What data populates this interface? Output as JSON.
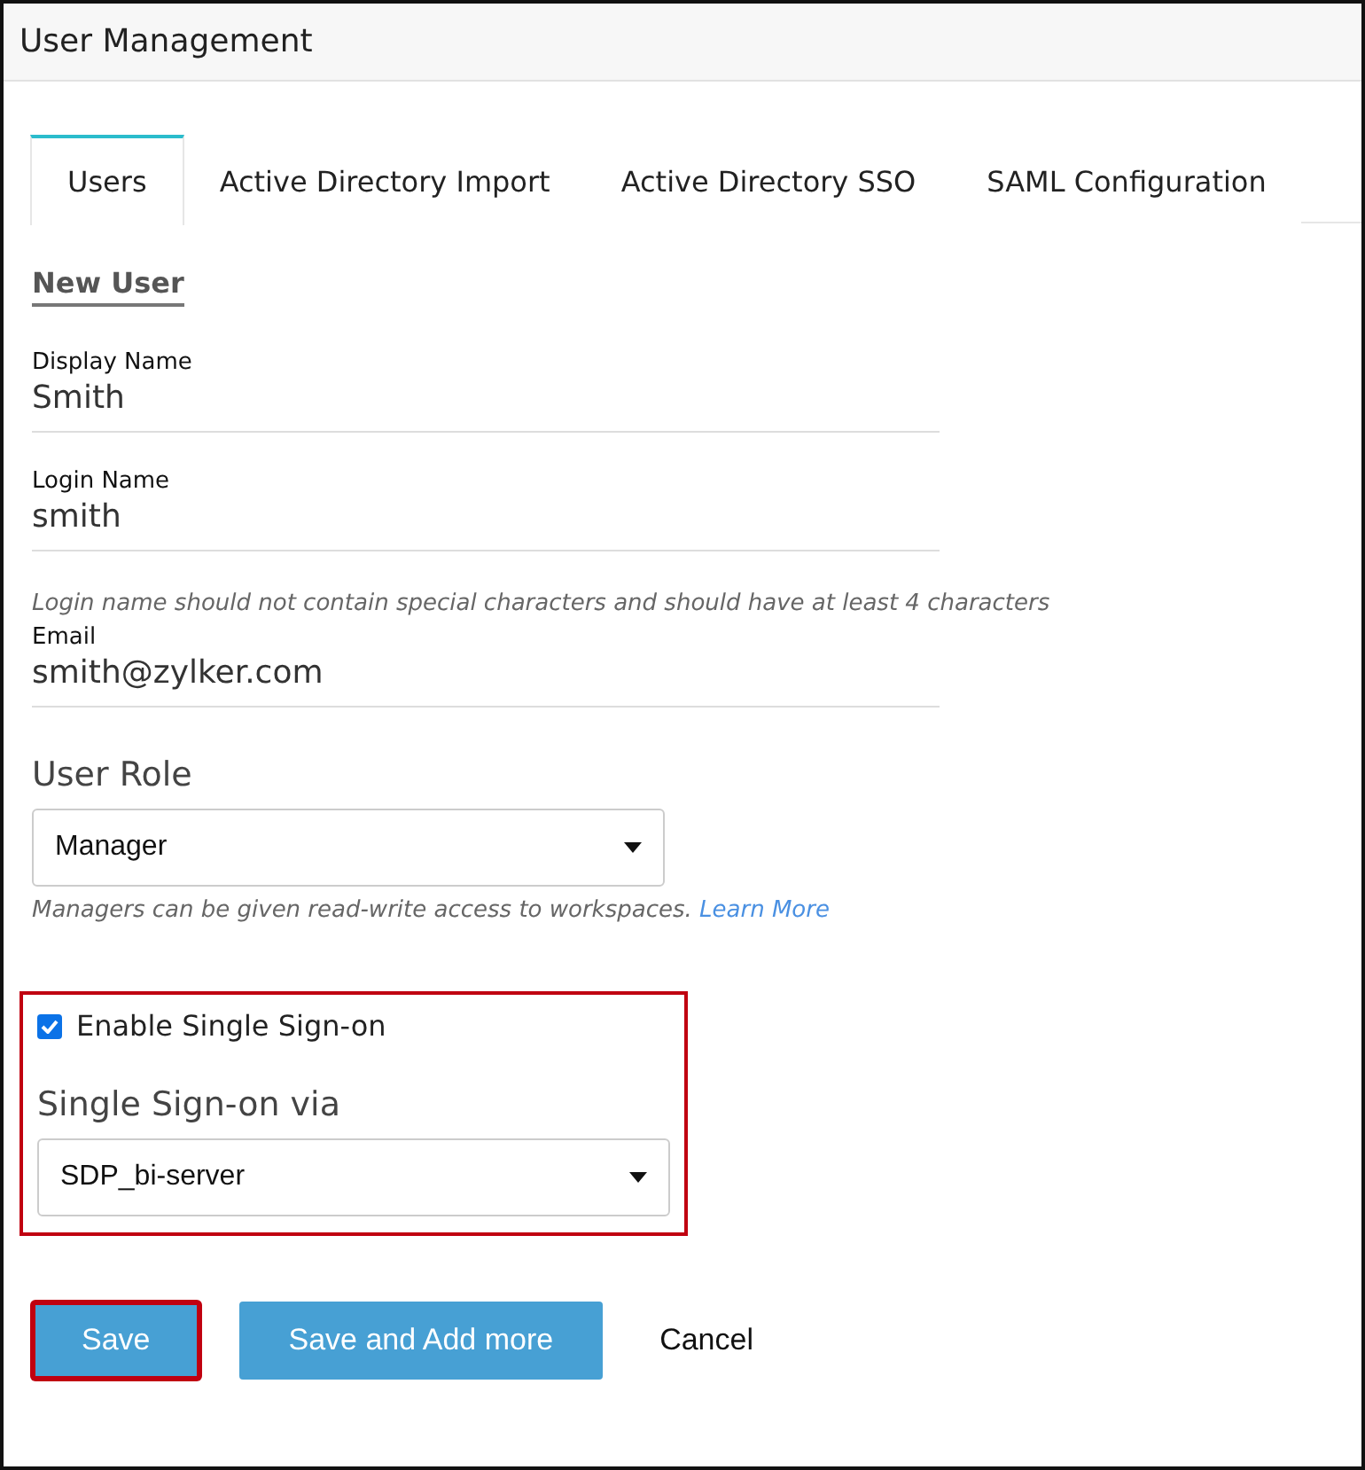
{
  "window": {
    "title": "User Management"
  },
  "tabs": [
    {
      "label": "Users",
      "selected": true
    },
    {
      "label": "Active Directory Import",
      "selected": false
    },
    {
      "label": "Active Directory SSO",
      "selected": false
    },
    {
      "label": "SAML Configuration",
      "selected": false
    }
  ],
  "section_title": "New User",
  "fields": [
    {
      "label": "Display Name",
      "value": "Smith"
    },
    {
      "label": "Login Name",
      "value": "smith",
      "hint": "Login name should not contain special characters and should have at least 4 characters"
    },
    {
      "label": "Email",
      "value": "smith@zylker.com"
    }
  ],
  "user_role": {
    "label": "User Role",
    "value": "Manager",
    "hint": "Managers can be given read-write access to workspaces.",
    "link": "Learn More"
  },
  "sso": {
    "highlighted": true,
    "checkbox": {
      "label": "Enable Single Sign-on",
      "checked": true
    },
    "label": "Single Sign-on via",
    "value": "SDP_bi-server"
  },
  "buttons": [
    {
      "label": "Save",
      "kind": "primary",
      "highlighted": true
    },
    {
      "label": "Save and Add more",
      "kind": "primary",
      "highlighted": false
    },
    {
      "label": "Cancel",
      "kind": "plain",
      "highlighted": false
    }
  ]
}
